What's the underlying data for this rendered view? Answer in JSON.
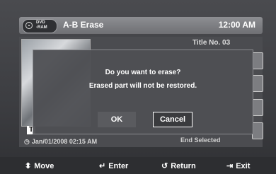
{
  "header": {
    "disc_label_line1": "DVD",
    "disc_label_line2": "-RAM",
    "title": "A-B Erase",
    "time": "12:00 AM"
  },
  "background": {
    "title_no": "Title No. 03",
    "t_icon": "T",
    "date": "Jan/01/2008  02:15 AM",
    "end_label": "End Selected"
  },
  "dialog": {
    "question": "Do you want to erase?",
    "warning": "Erased part will not be restored.",
    "ok_label": "OK",
    "cancel_label": "Cancel",
    "selected": "Cancel"
  },
  "footer": {
    "move": "Move",
    "enter": "Enter",
    "return": "Return",
    "exit": "Exit"
  },
  "icons": {
    "move": "up-down-arrow-icon",
    "enter": "enter-icon",
    "return": "return-icon",
    "exit": "exit-icon",
    "disc": "disc-icon",
    "clock": "clock-icon"
  }
}
